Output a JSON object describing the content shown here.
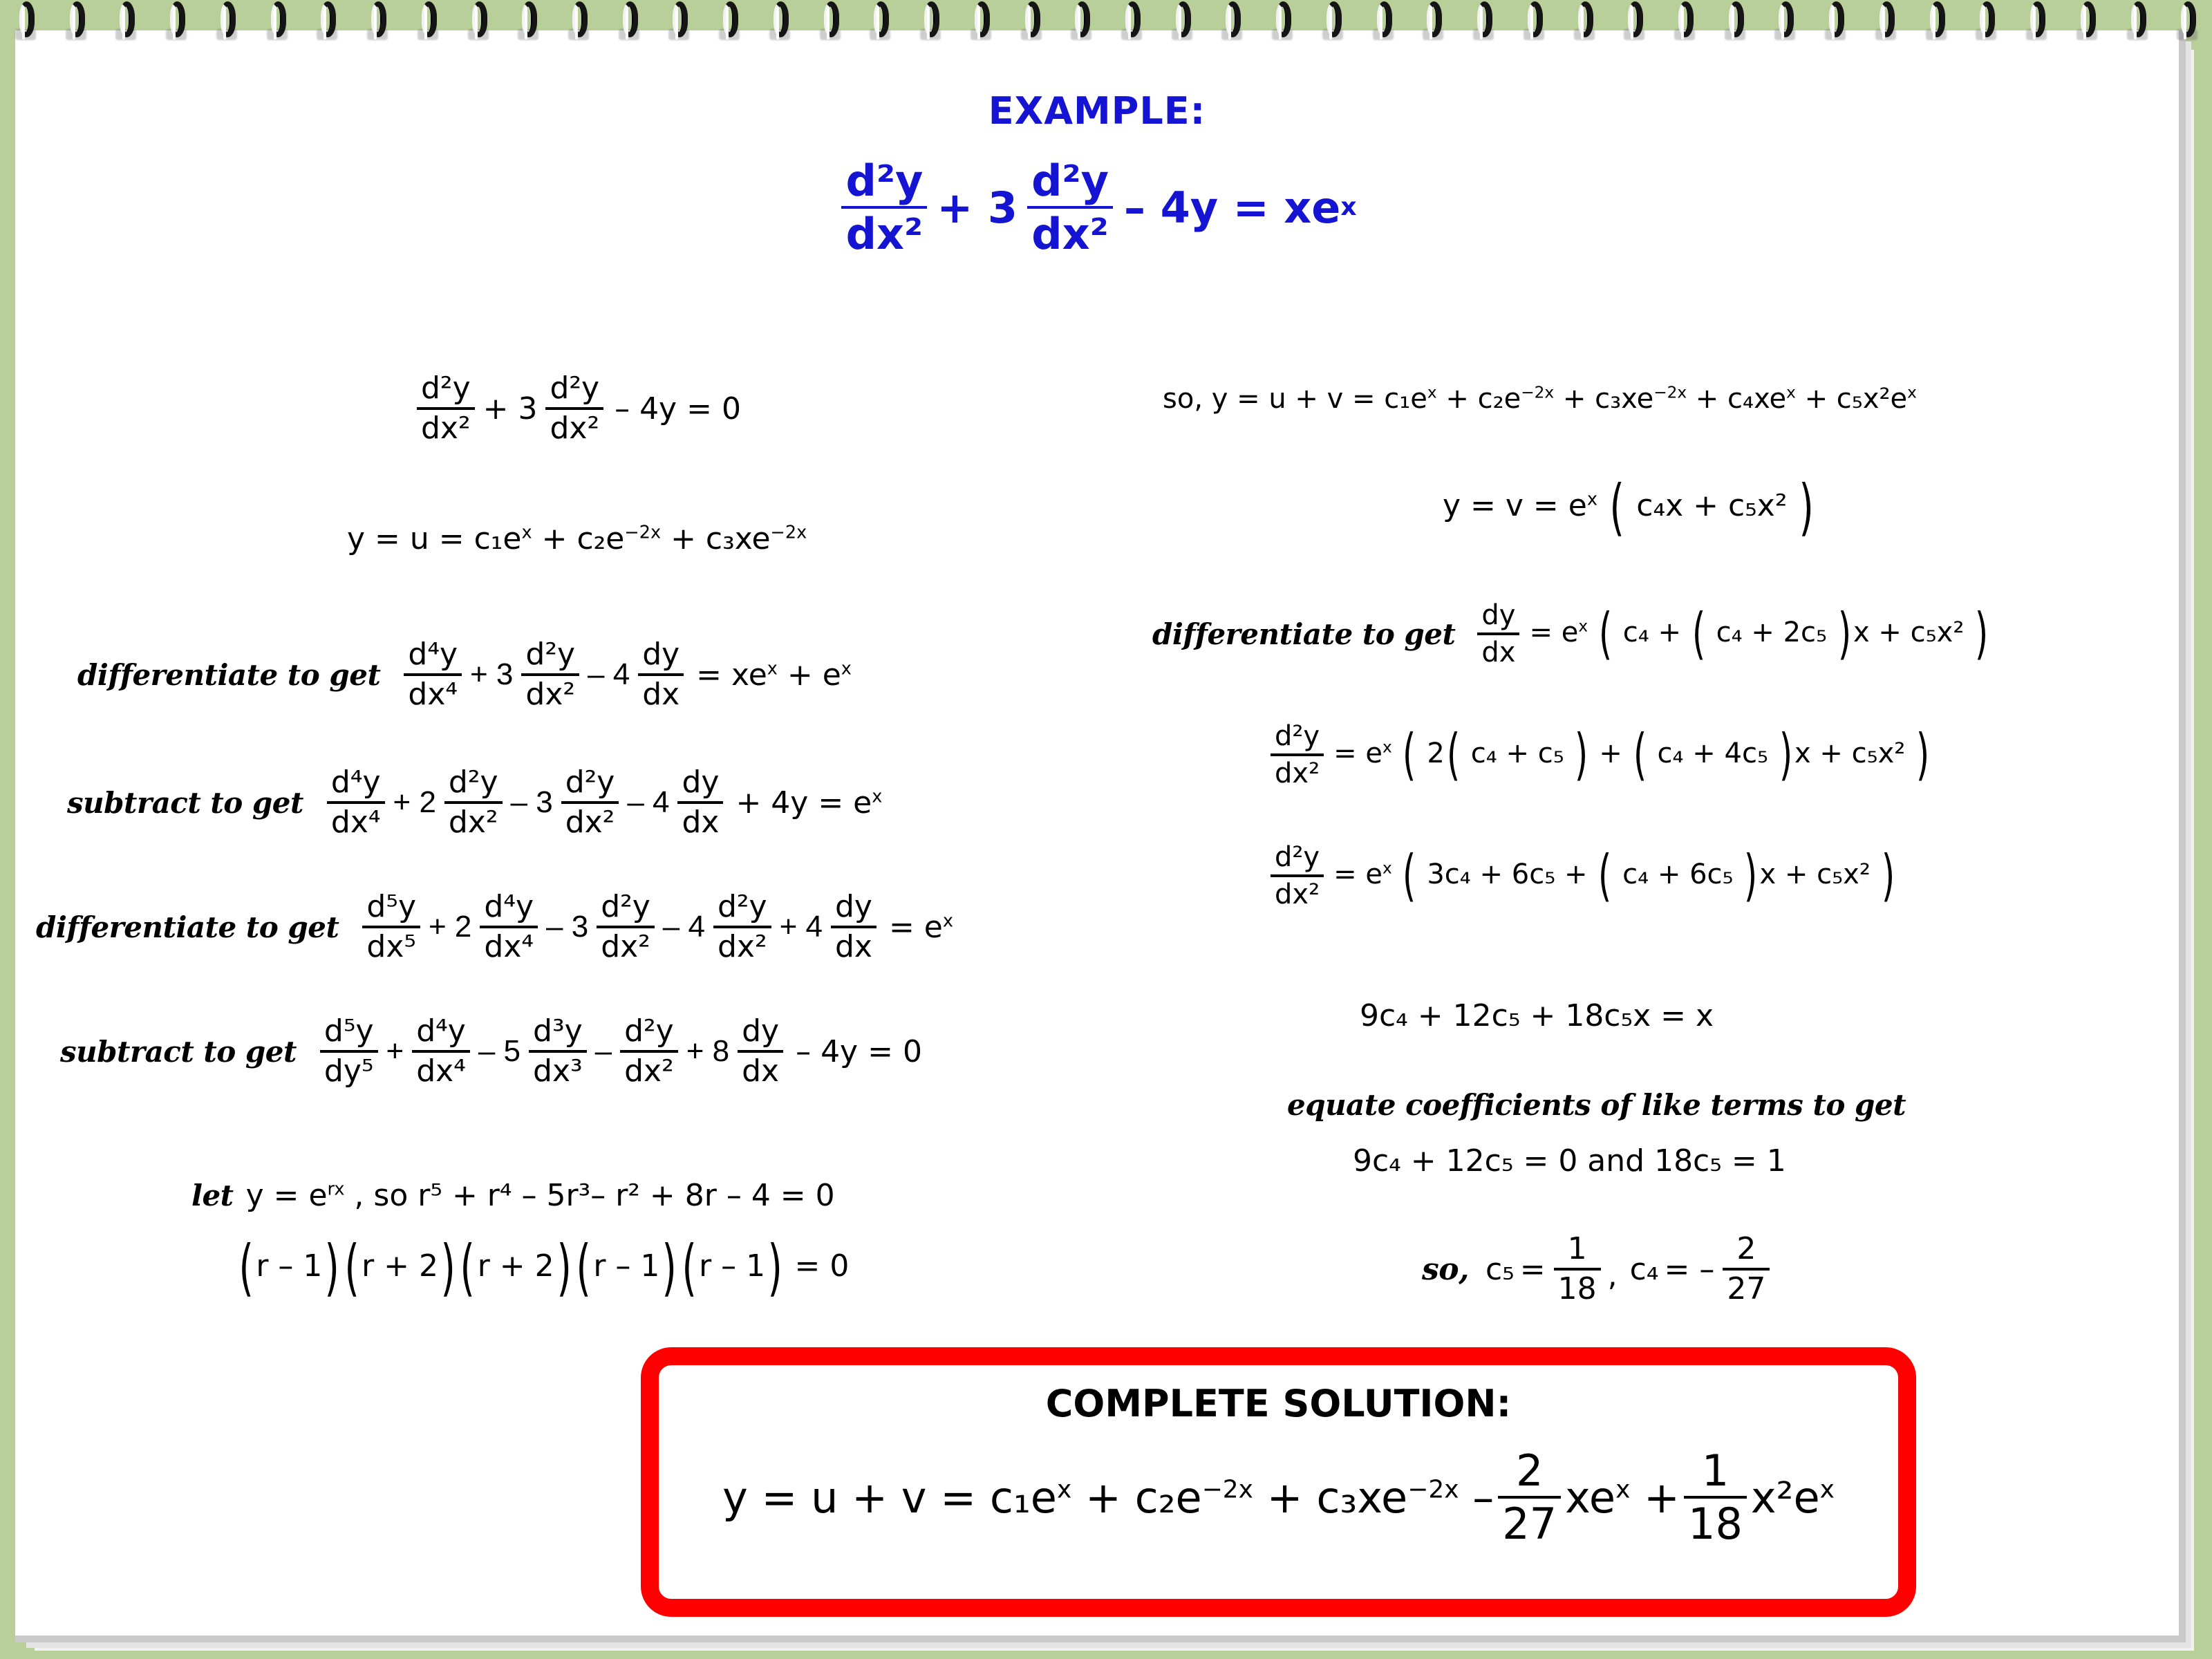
{
  "page": {
    "background_color": "#b8cf9a",
    "paper_color": "#ffffff",
    "accent_blue": "#1414d2",
    "accent_red": "#fe0000",
    "binding_ring_count": 44
  },
  "header": {
    "title": "EXAMPLE:",
    "main_equation": {
      "term1_num": "d²y",
      "term1_den": "dx²",
      "op1": "+ 3",
      "term2_num": "d²y",
      "term2_den": "dx²",
      "tail": "– 4y = xe",
      "tail_sup": "x"
    }
  },
  "left_column": {
    "homogeneous_equation": {
      "f1_num": "d²y",
      "f1_den": "dx²",
      "op1": "+ 3",
      "f2_num": "d²y",
      "f2_den": "dx²",
      "tail": "– 4y = 0"
    },
    "complementary_solution": "y = u = c₁e^x + c₂e^−2x + c₃xe^−2x",
    "steps": [
      {
        "label": "differentiate to get",
        "fractions": [
          {
            "coef": "",
            "num": "d⁴y",
            "den": "dx⁴"
          },
          {
            "coef": "+ 3",
            "num": "d²y",
            "den": "dx²"
          },
          {
            "coef": "– 4",
            "num": "dy",
            "den": "dx"
          }
        ],
        "tail": "= xe^x + e^x"
      },
      {
        "label": "subtract to get",
        "fractions": [
          {
            "coef": "",
            "num": "d⁴y",
            "den": "dx⁴"
          },
          {
            "coef": "+ 2",
            "num": "d²y",
            "den": "dx²"
          },
          {
            "coef": "– 3",
            "num": "d²y",
            "den": "dx²"
          },
          {
            "coef": "– 4",
            "num": "dy",
            "den": "dx"
          }
        ],
        "tail": "+ 4y = e^x"
      },
      {
        "label": "differentiate to get",
        "fractions": [
          {
            "coef": "",
            "num": "d⁵y",
            "den": "dx⁵"
          },
          {
            "coef": "+ 2",
            "num": "d⁴y",
            "den": "dx⁴"
          },
          {
            "coef": "– 3",
            "num": "d²y",
            "den": "dx²"
          },
          {
            "coef": "– 4",
            "num": "d²y",
            "den": "dx²"
          },
          {
            "coef": "+ 4",
            "num": "dy",
            "den": "dx"
          }
        ],
        "tail": "= e^x"
      },
      {
        "label": "subtract to get",
        "fractions": [
          {
            "coef": "",
            "num": "d⁵y",
            "den": "dy⁵"
          },
          {
            "coef": "+",
            "num": "d⁴y",
            "den": "dx⁴"
          },
          {
            "coef": "– 5",
            "num": "d³y",
            "den": "dx³"
          },
          {
            "coef": "–",
            "num": "d²y",
            "den": "dx²"
          },
          {
            "coef": "+ 8",
            "num": "dy",
            "den": "dx"
          }
        ],
        "tail": "– 4y = 0"
      }
    ],
    "characteristic_label": "let",
    "characteristic_equation": "y = e^rx , so r⁵ + r⁴ – 5r³– r² + 8r – 4 = 0",
    "factored_equation": "(r – 1)(r + 2)(r + 2)(r – 1)(r – 1) = 0"
  },
  "right_column": {
    "general_form": "so,  y = u + v = c₁e^x + c₂e^−2x + c₃xe^−2x + c₄xe^x + c₅x²e^x",
    "particular_form": "y = v = e^x ( c₄x + c₅x² )",
    "first_derivative": {
      "label": "differentiate to get",
      "num": "dy",
      "den": "dx",
      "rhs": "= e^x ( c₄ + ( c₄ + 2c₅ )x + c₅x² )"
    },
    "second_derivative_a": {
      "num": "d²y",
      "den": "dx²",
      "rhs": "= e^x ( 2( c₄ + c₅ ) + ( c₄ + 4c₅ )x + c₅x² )"
    },
    "second_derivative_b": {
      "num": "d²y",
      "den": "dx²",
      "rhs": "= e^x ( 3c₄ + 6c₅ + ( c₄ + 6c₅ )x + c₅x² )"
    },
    "collected": "9c₄ + 12c₅ + 18c₅x = x",
    "equate_label": "equate coefficients of like terms to get",
    "coefficient_equations": "9c₄ + 12c₅ = 0  and  18c₅ = 1",
    "solved_prefix": "so,",
    "c5_sym": "c₅",
    "c5_num": "1",
    "c5_den": "18",
    "comma": ",",
    "c4_sym": "c₄",
    "c4_sign": "= –",
    "c4_num": "2",
    "c4_den": "27"
  },
  "solution_box": {
    "title": "COMPLETE SOLUTION:",
    "equation_head": "y = u + v = c₁e^x + c₂e^−2x + c₃xe^−2x –",
    "frac1_num": "2",
    "frac1_den": "27",
    "mid": "xe^x +",
    "frac2_num": "1",
    "frac2_den": "18",
    "tail": "x²e^x"
  }
}
